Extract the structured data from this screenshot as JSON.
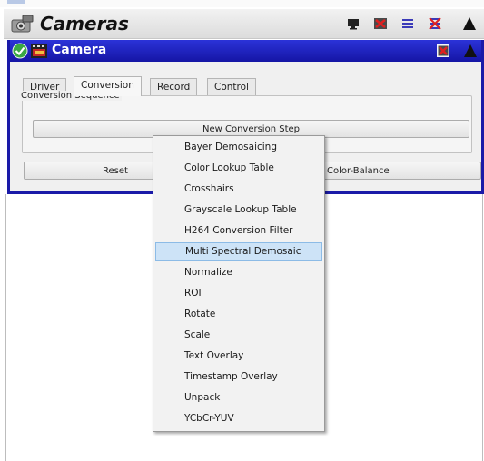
{
  "window": {
    "title": "Cameras"
  },
  "camera_panel": {
    "title": "Camera",
    "tabs": [
      {
        "label": "Driver"
      },
      {
        "label": "Conversion",
        "active": true
      },
      {
        "label": "Record"
      },
      {
        "label": "Control"
      }
    ],
    "group_title": "Conversion Sequence",
    "new_step_label": "New Conversion Step",
    "reset_label": "Reset",
    "color_balance_label": "Color-Balance"
  },
  "menu": {
    "items": [
      {
        "label": "Bayer Demosaicing"
      },
      {
        "label": "Color Lookup Table"
      },
      {
        "label": "Crosshairs"
      },
      {
        "label": "Grayscale Lookup Table"
      },
      {
        "label": "H264 Conversion Filter"
      },
      {
        "label": "Multi Spectral Demosaic",
        "highlighted": true
      },
      {
        "label": "Normalize"
      },
      {
        "label": "ROI"
      },
      {
        "label": "Rotate"
      },
      {
        "label": "Scale"
      },
      {
        "label": "Text Overlay"
      },
      {
        "label": "Timestamp Overlay"
      },
      {
        "label": "Unpack"
      },
      {
        "label": "YCbCr-YUV"
      }
    ]
  },
  "icons": {
    "window": "cameras-icon",
    "toolbar": [
      "monitor-icon",
      "close-window-icon",
      "menu-icon",
      "crossed-lines-icon",
      "collapse-triangle-icon"
    ],
    "camera_status": "check-icon",
    "camera_type": "film-icon",
    "camera_toolbar": [
      "close-window-icon",
      "collapse-triangle-icon"
    ]
  },
  "colors": {
    "camera_title_bar": "#1f22c7",
    "menu_highlight": "#cde3f7",
    "check_green": "#3aa844",
    "close_red": "#cc2222"
  }
}
